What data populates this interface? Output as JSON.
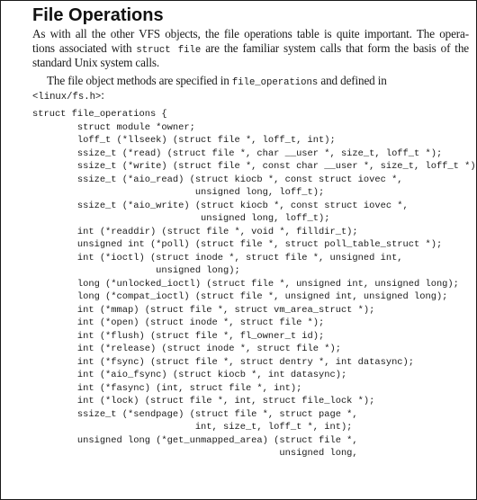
{
  "heading": "File Operations",
  "intro": {
    "line1": "As with all the other VFS objects, the file operations table is quite important. The opera-",
    "line2_pre": "tions associated with ",
    "line2_code": "struct file",
    "line2_post": " are the familiar system calls that form the basis of the",
    "line3": "standard Unix system calls."
  },
  "methods_para": {
    "line1_pre": "The file object methods are specified in ",
    "line1_code": "file_operations",
    "line1_post": " and defined in",
    "line2_code": "<linux/fs.h>",
    "line2_post": ":"
  },
  "code_lines": [
    "struct file_operations {",
    "        struct module *owner;",
    "        loff_t (*llseek) (struct file *, loff_t, int);",
    "        ssize_t (*read) (struct file *, char __user *, size_t, loff_t *);",
    "        ssize_t (*write) (struct file *, const char __user *, size_t, loff_t *);",
    "        ssize_t (*aio_read) (struct kiocb *, const struct iovec *,",
    "                             unsigned long, loff_t);",
    "        ssize_t (*aio_write) (struct kiocb *, const struct iovec *,",
    "                              unsigned long, loff_t);",
    "        int (*readdir) (struct file *, void *, filldir_t);",
    "        unsigned int (*poll) (struct file *, struct poll_table_struct *);",
    "        int (*ioctl) (struct inode *, struct file *, unsigned int,",
    "                      unsigned long);",
    "        long (*unlocked_ioctl) (struct file *, unsigned int, unsigned long);",
    "        long (*compat_ioctl) (struct file *, unsigned int, unsigned long);",
    "        int (*mmap) (struct file *, struct vm_area_struct *);",
    "        int (*open) (struct inode *, struct file *);",
    "        int (*flush) (struct file *, fl_owner_t id);",
    "        int (*release) (struct inode *, struct file *);",
    "        int (*fsync) (struct file *, struct dentry *, int datasync);",
    "        int (*aio_fsync) (struct kiocb *, int datasync);",
    "        int (*fasync) (int, struct file *, int);",
    "        int (*lock) (struct file *, int, struct file_lock *);",
    "        ssize_t (*sendpage) (struct file *, struct page *,",
    "                             int, size_t, loff_t *, int);",
    "        unsigned long (*get_unmapped_area) (struct file *,",
    "                                            unsigned long,"
  ]
}
